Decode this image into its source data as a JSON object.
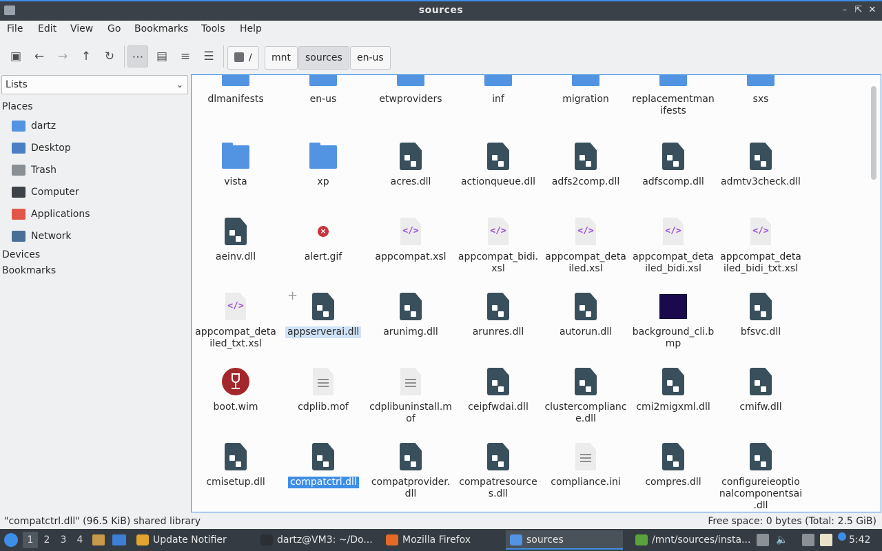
{
  "window": {
    "title": "sources"
  },
  "menu": [
    "File",
    "Edit",
    "View",
    "Go",
    "Bookmarks",
    "Tools",
    "Help"
  ],
  "breadcrumb": [
    "/",
    "mnt",
    "sources",
    "en-us"
  ],
  "sidebar": {
    "select": "Lists",
    "places_label": "Places",
    "places": [
      {
        "label": "dartz",
        "icon": "home-folder-icon",
        "color": "#5294e2"
      },
      {
        "label": "Desktop",
        "icon": "desktop-icon",
        "color": "#4a7fc4"
      },
      {
        "label": "Trash",
        "icon": "trash-icon",
        "color": "#8a8f94"
      },
      {
        "label": "Computer",
        "icon": "computer-icon",
        "color": "#3c4247"
      },
      {
        "label": "Applications",
        "icon": "applications-icon",
        "color": "#e0574a"
      },
      {
        "label": "Network",
        "icon": "network-icon",
        "color": "#4a6f96"
      }
    ],
    "devices_label": "Devices",
    "bookmarks_label": "Bookmarks"
  },
  "files": [
    {
      "name": "dlmanifests",
      "type": "folder"
    },
    {
      "name": "en-us",
      "type": "folder"
    },
    {
      "name": "etwproviders",
      "type": "folder"
    },
    {
      "name": "inf",
      "type": "folder"
    },
    {
      "name": "migration",
      "type": "folder"
    },
    {
      "name": "replacementmanifests",
      "type": "folder",
      "lines": [
        "replacementman",
        "ifests"
      ]
    },
    {
      "name": "sxs",
      "type": "folder"
    },
    {
      "name": "vista",
      "type": "folder"
    },
    {
      "name": "xp",
      "type": "folder"
    },
    {
      "name": "acres.dll",
      "type": "dll"
    },
    {
      "name": "actionqueue.dll",
      "type": "dll"
    },
    {
      "name": "adfs2comp.dll",
      "type": "dll"
    },
    {
      "name": "adfscomp.dll",
      "type": "dll"
    },
    {
      "name": "admtv3check.dll",
      "type": "dll"
    },
    {
      "name": "aeinv.dll",
      "type": "dll"
    },
    {
      "name": "alert.gif",
      "type": "gif"
    },
    {
      "name": "appcompat.xsl",
      "type": "xsl"
    },
    {
      "name": "appcompat_bidi.xsl",
      "type": "xsl",
      "lines": [
        "appcompat_bidi.",
        "xsl"
      ]
    },
    {
      "name": "appcompat_detailed.xsl",
      "type": "xsl",
      "lines": [
        "appcompat_deta",
        "iled.xsl"
      ]
    },
    {
      "name": "appcompat_detailed_bidi.xsl",
      "type": "xsl",
      "lines": [
        "appcompat_deta",
        "iled_bidi.xsl"
      ]
    },
    {
      "name": "appcompat_detailed_bidi_txt.xsl",
      "type": "xsl",
      "lines": [
        "appcompat_deta",
        "iled_bidi_txt.xsl"
      ]
    },
    {
      "name": "appcompat_detailed_txt.xsl",
      "type": "xsl",
      "lines": [
        "appcompat_deta",
        "iled_txt.xsl"
      ]
    },
    {
      "name": "appserverai.dll",
      "type": "dll",
      "state": "hover"
    },
    {
      "name": "arunimg.dll",
      "type": "dll"
    },
    {
      "name": "arunres.dll",
      "type": "dll"
    },
    {
      "name": "autorun.dll",
      "type": "dll"
    },
    {
      "name": "background_cli.bmp",
      "type": "bmp",
      "lines": [
        "background_cli.b",
        "mp"
      ]
    },
    {
      "name": "bfsvc.dll",
      "type": "dll"
    },
    {
      "name": "boot.wim",
      "type": "wim"
    },
    {
      "name": "cdplib.mof",
      "type": "text"
    },
    {
      "name": "cdplibuninstall.mof",
      "type": "text",
      "lines": [
        "cdplibuninstall.m",
        "of"
      ]
    },
    {
      "name": "ceipfwdai.dll",
      "type": "dll"
    },
    {
      "name": "clustercompliance.dll",
      "type": "dll",
      "lines": [
        "clustercomplianc",
        "e.dll"
      ]
    },
    {
      "name": "cmi2migxml.dll",
      "type": "dll"
    },
    {
      "name": "cmifw.dll",
      "type": "dll"
    },
    {
      "name": "cmisetup.dll",
      "type": "dll"
    },
    {
      "name": "compatctrl.dll",
      "type": "dll",
      "state": "selected"
    },
    {
      "name": "compatprovider.dll",
      "type": "dll",
      "lines": [
        "compatprovider.",
        "dll"
      ]
    },
    {
      "name": "compatresources.dll",
      "type": "dll",
      "lines": [
        "compatresource",
        "s.dll"
      ]
    },
    {
      "name": "compliance.ini",
      "type": "text"
    },
    {
      "name": "compres.dll",
      "type": "dll"
    },
    {
      "name": "configureieoptionalcomponentsai.dll",
      "type": "dll",
      "lines": [
        "configureieoptio",
        "nalcomponentsai",
        ".dll"
      ]
    }
  ],
  "status": {
    "left": "\"compatctrl.dll\" (96.5 KiB) shared library",
    "right": "Free space: 0 bytes (Total: 2.5 GiB)"
  },
  "taskbar": {
    "workspaces": [
      "1",
      "2",
      "3",
      "4"
    ],
    "tasks": [
      {
        "label": "Update Notifier",
        "icon": "update-notifier-icon",
        "color": "#e2a42c"
      },
      {
        "label": "dartz@VM3: ~/Do...",
        "icon": "terminal-icon",
        "color": "#2b2f33"
      },
      {
        "label": "Mozilla Firefox",
        "icon": "firefox-icon",
        "color": "#e66a27"
      },
      {
        "label": "sources",
        "icon": "folder-icon",
        "color": "#5294e2",
        "active": true
      },
      {
        "label": "/mnt/sources/insta...",
        "icon": "archive-icon",
        "color": "#5aa33c"
      }
    ],
    "clock": "5:42"
  }
}
